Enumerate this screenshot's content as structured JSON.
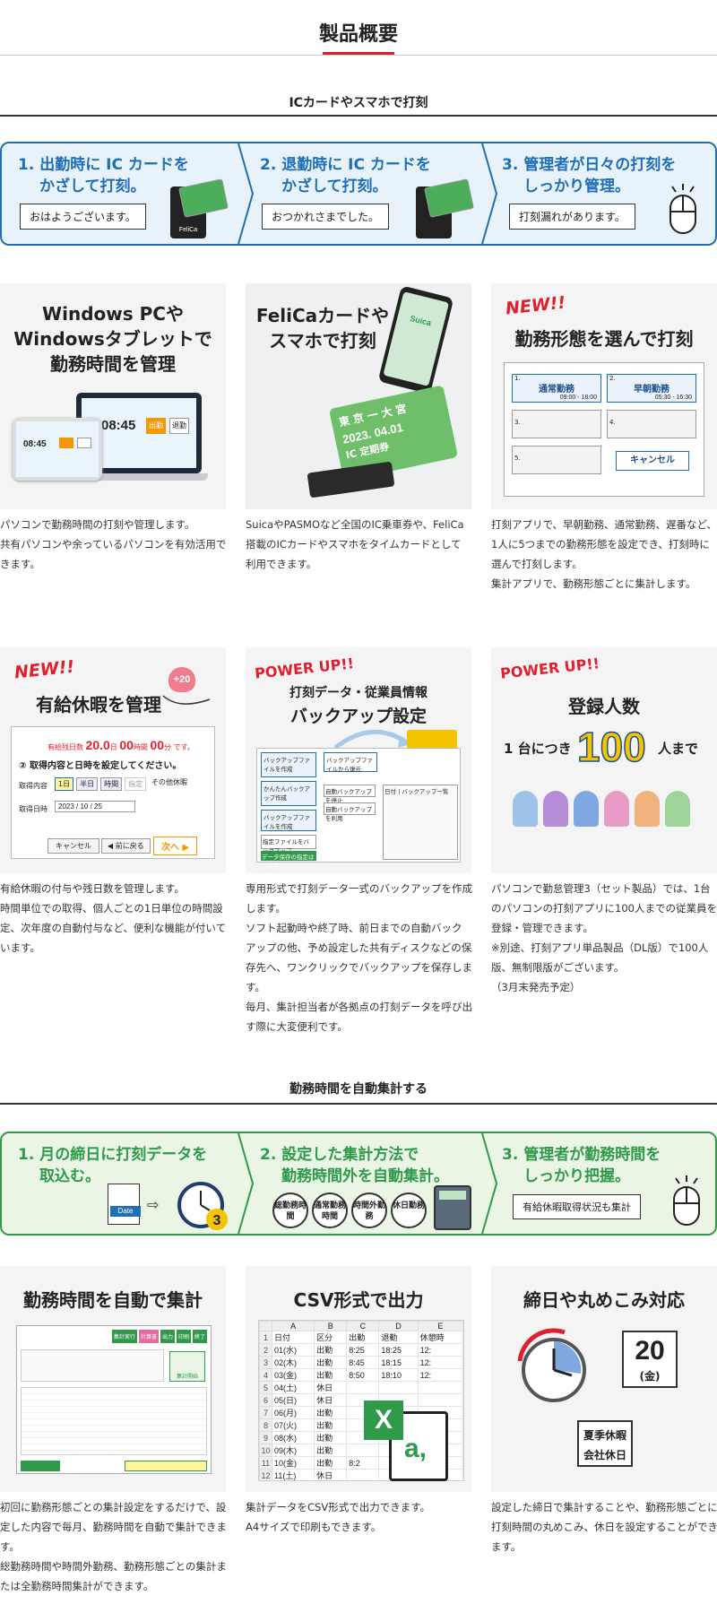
{
  "page_title": "製品概要",
  "section1": {
    "heading": "ICカードやスマホで打刻",
    "steps": [
      {
        "num": "1.",
        "line1": "出勤時に IC カードを",
        "line2": "かざして打刻。",
        "bubble": "おはようございます。"
      },
      {
        "num": "2.",
        "line1": "退勤時に IC カードを",
        "line2": "かざして打刻。",
        "bubble": "おつかれさまでした。"
      },
      {
        "num": "3.",
        "line1": "管理者が日々の打刻を",
        "line2": "しっかり管理。",
        "bubble": "打刻漏れがあります。"
      }
    ],
    "card_brand": "FeliCa"
  },
  "cards_row1": [
    {
      "title_l1": "Windows PCや",
      "title_l2": "Windowsタブレットで",
      "title_l3": "勤務時間を管理",
      "screen": {
        "time_big": "08:45",
        "time_small": "08:45",
        "btn_in": "出勤",
        "btn_out": "退勤"
      },
      "desc": [
        "パソコンで勤務時間の打刻や管理します。",
        "共有パソコンや余っているパソコンを有効活用で",
        "きます。"
      ]
    },
    {
      "title_l1": "FeliCaカードや",
      "title_l2": "スマホで打刻",
      "ic_text": [
        "東 京 一 大 宮",
        "2023. 04.01",
        "IC 定期券"
      ],
      "phone_brand": "Suica",
      "desc": [
        "SuicaやPASMOなど全国のIC乗車券や、FeliCa",
        "搭載のICカードやスマホをタイムカードとして",
        "利用できます。"
      ]
    },
    {
      "badge": "NEW!!",
      "title_l1": "勤務形態を選んで打刻",
      "slots": [
        {
          "no": "1.",
          "name": "通常勤務",
          "time": "09:00 - 18:00"
        },
        {
          "no": "2.",
          "name": "早朝勤務",
          "time": "05:30 - 16:30"
        },
        {
          "no": "3.",
          "name": ""
        },
        {
          "no": "4.",
          "name": ""
        },
        {
          "no": "5.",
          "name": ""
        }
      ],
      "cancel": "キャンセル",
      "desc": [
        "打刻アプリで、早朝勤務、通常勤務、遅番など、",
        "1人に5つまでの勤務形態を設定でき、打刻時に",
        "選んで打刻します。",
        "集計アプリで、勤務形態ごとに集計します。"
      ]
    }
  ],
  "cards_row2": [
    {
      "badge": "NEW!!",
      "title_l1": "有給休暇を管理",
      "heart": "+20",
      "form": {
        "remain_label": "有給残日数",
        "days": "20.0",
        "days_unit": "日",
        "hours": "00",
        "hours_unit": "時間",
        "mins": "00",
        "mins_unit": "分",
        "suffix": "です。",
        "prompt": "② 取得内容と日時を設定してください。",
        "type_label": "取得内容",
        "options": [
          "1日",
          "半日",
          "時間",
          "指定"
        ],
        "other_label": "その他休暇",
        "date_label": "取得日時",
        "date_value": "2023 / 10 / 25",
        "cancel": "キャンセル",
        "back": "◀ 前に戻る",
        "next": "次へ ▶"
      },
      "desc": [
        "有給休暇の付与や残日数を管理します。",
        "時間単位での取得、個人ごとの1日単位の時間設",
        "定、次年度の自動付与など、便利な機能が付いて",
        "います。"
      ]
    },
    {
      "badge": "POWER UP!!",
      "title_l1": "打刻データ・従業員情報",
      "title_l2": "バックアップ設定",
      "ui": {
        "b1": "バックアップファイルを作成",
        "b2": "かんたんバックアップ作成",
        "b3": "バックアップファイルを作成",
        "b4": "指定ファイルをバックアップ",
        "b5": "データ保存の指定はこちら",
        "b6": "バックアップファイルから復元",
        "b7": "自動バックアップを停止",
        "b8": "自動バックアップを利用",
        "list_head": "日付 | バックアップ一覧"
      },
      "desc": [
        "専用形式で打刻データ一式のバックアップを作成",
        "します。",
        "ソフト起動時や終了時、前日までの自動バック",
        "アップの他、予め設定した共有ディスクなどの保",
        "存先へ、ワンクリックでバックアップを保存しま",
        "す。",
        "毎月、集計担当者が各拠点の打刻データを呼び出",
        "す際に大変便利です。"
      ]
    },
    {
      "badge": "POWER UP!!",
      "title_l1": "登録人数",
      "prefix": "1 台につき",
      "number": "100",
      "suffix": "人まで",
      "desc": [
        "パソコンで勤怠管理3（セット製品）では、1台",
        "のパソコンの打刻アプリに100人までの従業員を",
        "登録・管理できます。",
        "※別途、打刻アプリ単品製品（DL版）で100人",
        "版、無制限版がございます。",
        "（3月末発売予定）"
      ]
    }
  ],
  "section2": {
    "heading": "勤務時間を自動集計する",
    "steps": [
      {
        "num": "1.",
        "line1": "月の締日に打刻データを",
        "line2": "取込む。",
        "doc_label": "Date"
      },
      {
        "num": "2.",
        "line1": "設定した集計方法で",
        "line2": "勤務時間外を自動集計。",
        "pills": [
          "総勤務時間",
          "通常勤務時間",
          "時間外勤務",
          "休日勤務"
        ]
      },
      {
        "num": "3.",
        "line1": "管理者が勤務時間を",
        "line2": "しっかり把握。",
        "bubble": "有給休暇取得状況も集計"
      }
    ]
  },
  "cards_row3": [
    {
      "title_l1": "勤務時間を自動で集計",
      "toolbar": [
        "集計実行",
        "計算書",
        "出力",
        "印刷",
        "終了"
      ],
      "side_btn": "集計開始",
      "desc": [
        "初回に勤務形態ごとの集計設定をするだけで、設",
        "定した内容で毎月、勤務時間を自動で集計できま",
        "す。",
        "総勤務時間や時間外勤務、勤務形態ごとの集計ま",
        "たは全勤務時間集計ができます。"
      ]
    },
    {
      "title_l1": "CSV形式で出力",
      "sheet": {
        "cols": [
          "A",
          "B",
          "C",
          "D",
          "E"
        ],
        "header": [
          "日付",
          "区分",
          "出勤",
          "退勤",
          "休憩時"
        ],
        "rows": [
          [
            "01(水)",
            "出勤",
            "8:25",
            "18:25",
            "12:"
          ],
          [
            "02(木)",
            "出勤",
            "8:45",
            "18:15",
            "12:"
          ],
          [
            "03(金)",
            "出勤",
            "8:50",
            "18:10",
            "12:"
          ],
          [
            "04(土)",
            "休日",
            "",
            "",
            ""
          ],
          [
            "05(日)",
            "休日",
            "",
            "",
            ""
          ],
          [
            "06(月)",
            "出勤",
            "",
            "",
            ""
          ],
          [
            "07(火)",
            "出勤",
            "",
            "",
            ""
          ],
          [
            "08(水)",
            "出勤",
            "",
            "",
            ""
          ],
          [
            "09(木)",
            "出勤",
            "",
            "",
            ""
          ],
          [
            "10(金)",
            "出勤",
            "8:2",
            "",
            ""
          ],
          [
            "11(土)",
            "休日",
            "",
            "",
            ""
          ],
          [
            "12(日)",
            "休日",
            "",
            "",
            ""
          ],
          [
            "13(月)",
            "出勤",
            "",
            "",
            ""
          ]
        ]
      },
      "csv_letter": "a,",
      "desc": [
        "集計データをCSV形式で出力できます。",
        "A4サイズで印刷もできます。"
      ]
    },
    {
      "title_l1": "締日や丸めこみ対応",
      "cal_day": "20",
      "cal_weekday": "(金)",
      "sign_l1": "夏季休暇",
      "sign_l2": "会社休日",
      "desc": [
        "設定した締日で集計することや、勤務形態ごとに",
        "打刻時間の丸めこみ、休日を設定することができ",
        "ます。"
      ]
    }
  ],
  "colors": {
    "accent": "#d0202e",
    "blue": "#1f6fb8",
    "green": "#2e9a4a",
    "step_bg_blue": "#e8f2fb",
    "step_bg_green": "#eaf5e6"
  }
}
